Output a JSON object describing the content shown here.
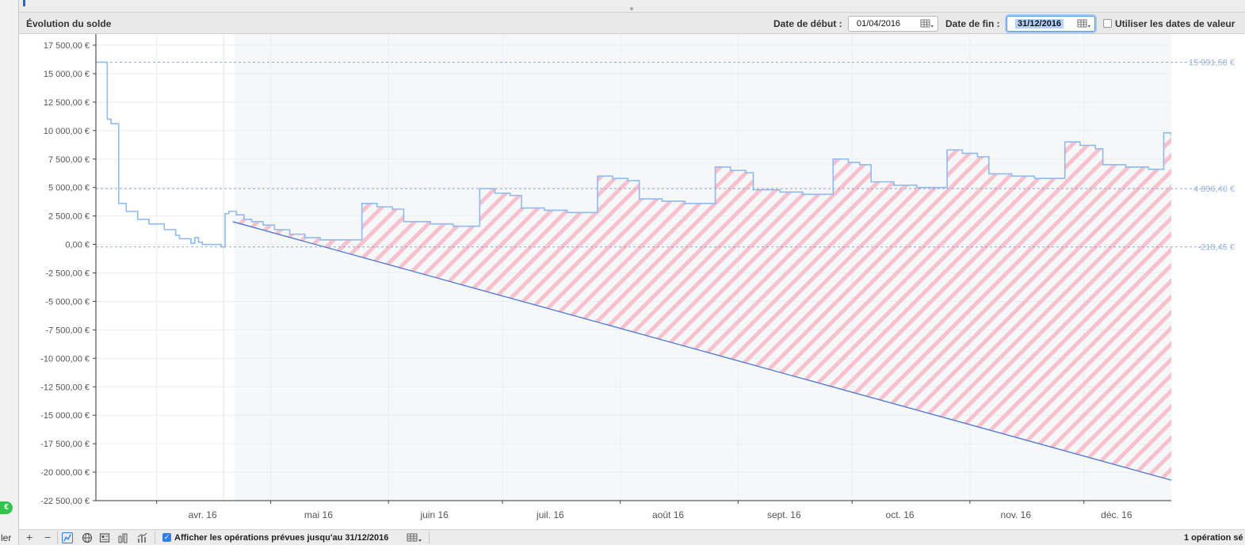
{
  "sidebar": {
    "badge_text": "€",
    "cut_label": "ler"
  },
  "header": {
    "title": "Évolution du solde",
    "start_label": "Date de début :",
    "start_value": "01/04/2016",
    "end_label": "Date de fin :",
    "end_value": "31/12/2016",
    "value_dates_label": "Utiliser les dates de valeur",
    "value_dates_checked": false
  },
  "toolbar": {
    "add_label": "+",
    "remove_label": "−",
    "show_planned_label": "Afficher les opérations prévues jusqu'au 31/12/2016",
    "show_planned_checked": true,
    "status_text": "1 opération sé"
  },
  "chart_data": {
    "type": "line",
    "title": "Évolution du solde",
    "xlabel": "",
    "ylabel": "",
    "ylim": [
      -22500,
      17500
    ],
    "y_ticks": [
      17500,
      15000,
      12500,
      10000,
      7500,
      5000,
      2500,
      0,
      -2500,
      -5000,
      -7500,
      -10000,
      -12500,
      -15000,
      -17500,
      -20000,
      -22500
    ],
    "y_tick_labels": [
      "17 500,00 €",
      "15 000,00 €",
      "12 500,00 €",
      "10 000,00 €",
      "7 500,00 €",
      "5 000,00 €",
      "2 500,00 €",
      "0,00 €",
      "-2 500,00 €",
      "-5 000,00 €",
      "-7 500,00 €",
      "-10 000,00 €",
      "-12 500,00 €",
      "-15 000,00 €",
      "-17 500,00 €",
      "-20 000,00 €",
      "-22 500,00 €"
    ],
    "xlim": [
      "2016-03-16",
      "2016-12-24"
    ],
    "x_ticks": [
      "2016-04-01",
      "2016-05-01",
      "2016-06-01",
      "2016-07-01",
      "2016-08-01",
      "2016-09-01",
      "2016-10-01",
      "2016-11-01",
      "2016-12-01"
    ],
    "x_tick_labels": [
      "avr. 16",
      "mai 16",
      "juin 16",
      "juil. 16",
      "août 16",
      "sept. 16",
      "oct. 16",
      "nov. 16",
      "déc. 16"
    ],
    "today": "2016-04-19",
    "reference_lines": [
      {
        "value": 15991.58,
        "label": "15 991,58 €"
      },
      {
        "value": 4896.4,
        "label": "4 896,40 €"
      },
      {
        "value": -218.45,
        "label": "-218,45 €"
      }
    ],
    "series": [
      {
        "name": "",
        "style": "step",
        "color": "#8fbbef",
        "points": [
          [
            "2016-03-16",
            16000
          ],
          [
            "2016-03-19",
            15900
          ],
          [
            "2016-03-19",
            11000
          ],
          [
            "2016-03-20",
            10600
          ],
          [
            "2016-03-22",
            10100
          ],
          [
            "2016-03-22",
            3600
          ],
          [
            "2016-03-24",
            2900
          ],
          [
            "2016-03-27",
            2800
          ],
          [
            "2016-03-27",
            2200
          ],
          [
            "2016-03-30",
            1800
          ],
          [
            "2016-04-03",
            1300
          ],
          [
            "2016-04-06",
            800
          ],
          [
            "2016-04-07",
            500
          ],
          [
            "2016-04-10",
            100
          ],
          [
            "2016-04-11",
            600
          ],
          [
            "2016-04-12",
            200
          ],
          [
            "2016-04-13",
            0
          ],
          [
            "2016-04-18",
            -218.45
          ],
          [
            "2016-04-19",
            2700
          ],
          [
            "2016-04-20",
            2900
          ],
          [
            "2016-04-22",
            2600
          ],
          [
            "2016-04-24",
            2200
          ],
          [
            "2016-04-26",
            2000
          ],
          [
            "2016-04-29",
            1700
          ],
          [
            "2016-05-02",
            1300
          ],
          [
            "2016-05-06",
            900
          ],
          [
            "2016-05-10",
            600
          ],
          [
            "2016-05-14",
            400
          ],
          [
            "2016-05-25",
            400
          ],
          [
            "2016-05-25",
            3600
          ],
          [
            "2016-05-29",
            3300
          ],
          [
            "2016-06-02",
            3100
          ],
          [
            "2016-06-05",
            2000
          ],
          [
            "2016-06-12",
            1800
          ],
          [
            "2016-06-18",
            1600
          ],
          [
            "2016-06-25",
            1600
          ],
          [
            "2016-06-25",
            4900
          ],
          [
            "2016-06-29",
            4500
          ],
          [
            "2016-07-03",
            4300
          ],
          [
            "2016-07-06",
            3200
          ],
          [
            "2016-07-12",
            3000
          ],
          [
            "2016-07-18",
            2800
          ],
          [
            "2016-07-26",
            2800
          ],
          [
            "2016-07-26",
            6000
          ],
          [
            "2016-07-30",
            5800
          ],
          [
            "2016-08-03",
            5600
          ],
          [
            "2016-08-06",
            4000
          ],
          [
            "2016-08-12",
            3800
          ],
          [
            "2016-08-18",
            3600
          ],
          [
            "2016-08-26",
            3600
          ],
          [
            "2016-08-26",
            6800
          ],
          [
            "2016-08-30",
            6500
          ],
          [
            "2016-09-03",
            6300
          ],
          [
            "2016-09-05",
            4800
          ],
          [
            "2016-09-12",
            4600
          ],
          [
            "2016-09-18",
            4400
          ],
          [
            "2016-09-26",
            4400
          ],
          [
            "2016-09-26",
            7500
          ],
          [
            "2016-09-30",
            7200
          ],
          [
            "2016-10-03",
            7000
          ],
          [
            "2016-10-06",
            5500
          ],
          [
            "2016-10-12",
            5200
          ],
          [
            "2016-10-18",
            5000
          ],
          [
            "2016-10-26",
            5000
          ],
          [
            "2016-10-26",
            8300
          ],
          [
            "2016-10-30",
            8000
          ],
          [
            "2016-11-03",
            7700
          ],
          [
            "2016-11-06",
            6200
          ],
          [
            "2016-11-12",
            6000
          ],
          [
            "2016-11-18",
            5800
          ],
          [
            "2016-11-26",
            5800
          ],
          [
            "2016-11-26",
            9000
          ],
          [
            "2016-11-30",
            8700
          ],
          [
            "2016-12-04",
            8400
          ],
          [
            "2016-12-06",
            7000
          ],
          [
            "2016-12-12",
            6800
          ],
          [
            "2016-12-18",
            6600
          ],
          [
            "2016-12-22",
            6600
          ],
          [
            "2016-12-22",
            9800
          ],
          [
            "2016-12-24",
            9500
          ]
        ]
      },
      {
        "name": "",
        "style": "line",
        "color": "#4a78d6",
        "points": [
          [
            "2016-04-21",
            2000
          ],
          [
            "2016-12-24",
            -20700
          ]
        ]
      }
    ],
    "hatch_color": "#f4a5b8",
    "plot_bg_future": "#f6f7f9"
  }
}
